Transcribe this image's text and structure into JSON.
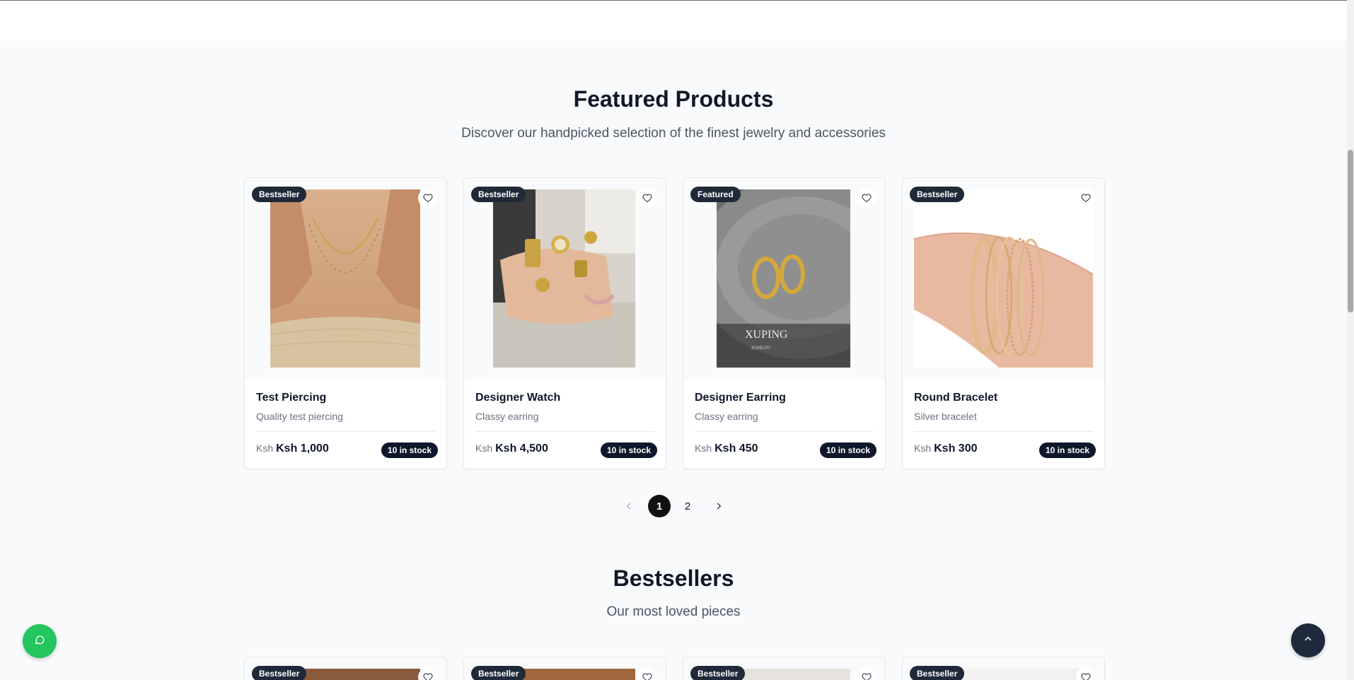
{
  "featured": {
    "title": "Featured Products",
    "subtitle": "Discover our handpicked selection of the finest jewelry and accessories",
    "products": [
      {
        "badge": "Bestseller",
        "name": "Test Piercing",
        "description": "Quality test piercing",
        "currency": "Ksh",
        "price": "Ksh 1,000",
        "stock": "10 in stock",
        "image": "gold-necklace-photo"
      },
      {
        "badge": "Bestseller",
        "name": "Designer Watch",
        "description": "Classy earring",
        "currency": "Ksh",
        "price": "Ksh 4,500",
        "stock": "10 in stock",
        "image": "gold-watches-on-hand-photo"
      },
      {
        "badge": "Featured",
        "name": "Designer Earring",
        "description": "Classy earring",
        "currency": "Ksh",
        "price": "Ksh 450",
        "stock": "10 in stock",
        "image": "gold-hoop-earrings-photo"
      },
      {
        "badge": "Bestseller",
        "name": "Round Bracelet",
        "description": "Silver bracelet",
        "currency": "Ksh",
        "price": "Ksh 300",
        "stock": "10 in stock",
        "image": "bangle-bracelets-photo"
      }
    ]
  },
  "pagination": {
    "pages": [
      "1",
      "2"
    ],
    "current": "1",
    "prev_icon": "chevron-left-icon",
    "next_icon": "chevron-right-icon"
  },
  "bestsellers": {
    "title": "Bestsellers",
    "subtitle": "Our most loved pieces",
    "badges": [
      "Bestseller",
      "Bestseller",
      "Bestseller",
      "Bestseller"
    ]
  },
  "image_watermark": "XUPING",
  "image_watermark_sub": "JEWELRY",
  "floating": {
    "chat_icon": "chat-bubble-icon",
    "chat_color": "#22c55e",
    "top_icon": "chevron-up-icon",
    "top_color": "#1e293b"
  }
}
